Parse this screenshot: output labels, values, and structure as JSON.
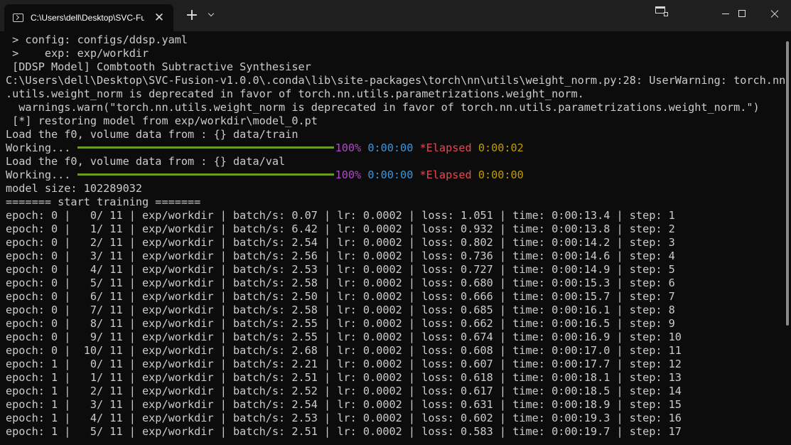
{
  "window": {
    "tab_title": "C:\\Users\\dell\\Desktop\\SVC-Fu",
    "icons": {
      "tab": "terminal-icon",
      "close_tab": "close-icon",
      "new_tab": "plus-icon",
      "tab_menu": "chevron-down-icon"
    },
    "glyphs": {
      "close_tab": "✕",
      "new_tab": "+"
    }
  },
  "terminal": {
    "lines": [
      " > config: configs/ddsp.yaml",
      " >    exp: exp/workdir",
      " [DDSP Model] Combtooth Subtractive Synthesiser",
      "C:\\Users\\dell\\Desktop\\SVC-Fusion-v1.0.0\\.conda\\lib\\site-packages\\torch\\nn\\utils\\weight_norm.py:28: UserWarning: torch.nn",
      ".utils.weight_norm is deprecated in favor of torch.nn.utils.parametrizations.weight_norm.",
      "  warnings.warn(\"torch.nn.utils.weight_norm is deprecated in favor of torch.nn.utils.parametrizations.weight_norm.\")",
      " [*] restoring model from exp/workdir\\model_0.pt",
      "Load the f0, volume data from : {} data/train"
    ],
    "progress_train": {
      "label": "Working... ",
      "percent": "100%",
      "time": "0:00:00",
      "elapsed_label": "*Elapsed",
      "elapsed": "0:00:02",
      "fraction": 1.0
    },
    "load_val": "Load the f0, volume data from : {} data/val",
    "progress_val": {
      "label": "Working... ",
      "percent": "100%",
      "time": "0:00:00",
      "elapsed_label": "*Elapsed",
      "elapsed": "0:00:00",
      "fraction": 1.0
    },
    "model_size": "model size: 102289032",
    "start_training": "======= start training =======",
    "epochs": [
      "epoch: 0 |   0/ 11 | exp/workdir | batch/s: 0.07 | lr: 0.0002 | loss: 1.051 | time: 0:00:13.4 | step: 1",
      "epoch: 0 |   1/ 11 | exp/workdir | batch/s: 6.42 | lr: 0.0002 | loss: 0.932 | time: 0:00:13.8 | step: 2",
      "epoch: 0 |   2/ 11 | exp/workdir | batch/s: 2.54 | lr: 0.0002 | loss: 0.802 | time: 0:00:14.2 | step: 3",
      "epoch: 0 |   3/ 11 | exp/workdir | batch/s: 2.56 | lr: 0.0002 | loss: 0.736 | time: 0:00:14.6 | step: 4",
      "epoch: 0 |   4/ 11 | exp/workdir | batch/s: 2.53 | lr: 0.0002 | loss: 0.727 | time: 0:00:14.9 | step: 5",
      "epoch: 0 |   5/ 11 | exp/workdir | batch/s: 2.58 | lr: 0.0002 | loss: 0.680 | time: 0:00:15.3 | step: 6",
      "epoch: 0 |   6/ 11 | exp/workdir | batch/s: 2.50 | lr: 0.0002 | loss: 0.666 | time: 0:00:15.7 | step: 7",
      "epoch: 0 |   7/ 11 | exp/workdir | batch/s: 2.58 | lr: 0.0002 | loss: 0.685 | time: 0:00:16.1 | step: 8",
      "epoch: 0 |   8/ 11 | exp/workdir | batch/s: 2.55 | lr: 0.0002 | loss: 0.662 | time: 0:00:16.5 | step: 9",
      "epoch: 0 |   9/ 11 | exp/workdir | batch/s: 2.55 | lr: 0.0002 | loss: 0.674 | time: 0:00:16.9 | step: 10",
      "epoch: 0 |  10/ 11 | exp/workdir | batch/s: 2.68 | lr: 0.0002 | loss: 0.608 | time: 0:00:17.0 | step: 11",
      "epoch: 1 |   0/ 11 | exp/workdir | batch/s: 2.21 | lr: 0.0002 | loss: 0.607 | time: 0:00:17.7 | step: 12",
      "epoch: 1 |   1/ 11 | exp/workdir | batch/s: 2.51 | lr: 0.0002 | loss: 0.618 | time: 0:00:18.1 | step: 13",
      "epoch: 1 |   2/ 11 | exp/workdir | batch/s: 2.52 | lr: 0.0002 | loss: 0.617 | time: 0:00:18.5 | step: 14",
      "epoch: 1 |   3/ 11 | exp/workdir | batch/s: 2.54 | lr: 0.0002 | loss: 0.631 | time: 0:00:18.9 | step: 15",
      "epoch: 1 |   4/ 11 | exp/workdir | batch/s: 2.53 | lr: 0.0002 | loss: 0.602 | time: 0:00:19.3 | step: 16",
      "epoch: 1 |   5/ 11 | exp/workdir | batch/s: 2.51 | lr: 0.0002 | loss: 0.583 | time: 0:00:19.7 | step: 17"
    ]
  },
  "colors": {
    "background": "#0c0c0c",
    "titlebar": "#1f1f1f",
    "text": "#cccccc",
    "progress_bar": "#6a9a1f",
    "percent": "#b148c6",
    "time": "#3a96dd",
    "elapsed": "#e74856",
    "elapsed_time": "#c19c00"
  }
}
